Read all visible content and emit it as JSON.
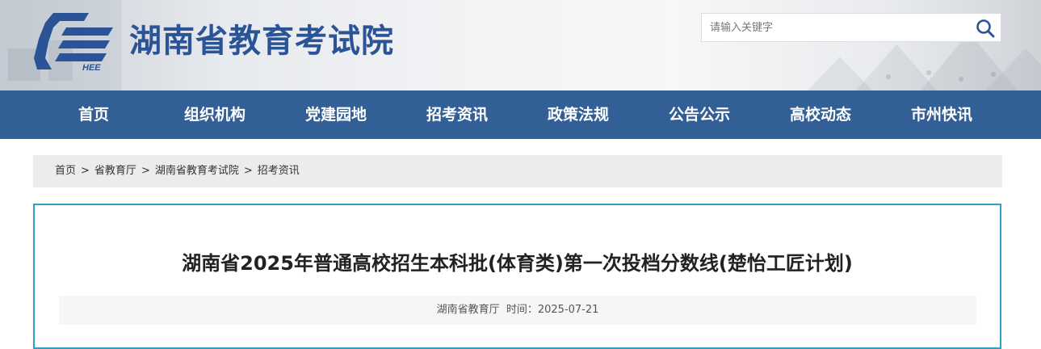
{
  "header": {
    "site_title": "湖南省教育考试院",
    "logo_text": "HEE",
    "search": {
      "placeholder": "请输入关键字",
      "value": ""
    }
  },
  "nav": {
    "items": [
      "首页",
      "组织机构",
      "党建园地",
      "招考资讯",
      "政策法规",
      "公告公示",
      "高校动态",
      "市州快讯"
    ]
  },
  "breadcrumb": {
    "items": [
      "首页",
      "省教育厅",
      "湖南省教育考试院",
      "招考资讯"
    ],
    "separator": ">"
  },
  "article": {
    "title": "湖南省2025年普通高校招生本科批(体育类)第一次投档分数线(楚怡工匠计划)",
    "source": "湖南省教育厅",
    "time_label": "时间：",
    "date": "2025-07-21"
  },
  "colors": {
    "brand_blue": "#2a5496",
    "nav_bg": "#335f97",
    "article_border": "#2f9fc6",
    "breadcrumb_bg": "#ececec"
  },
  "icons": {
    "search": "search-icon",
    "logo": "hee-logo"
  }
}
